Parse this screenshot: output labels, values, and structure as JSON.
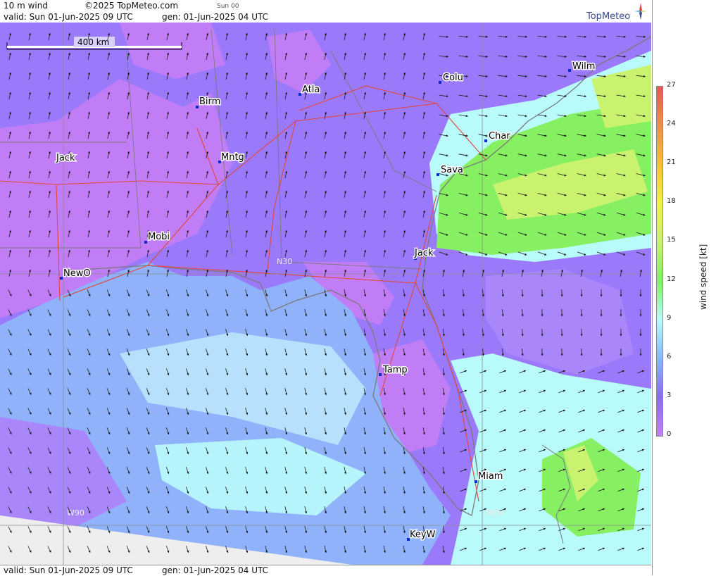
{
  "header": {
    "product": "10 m wind",
    "copyright": "©2025 TopMeteo.com",
    "step": "Sun 00",
    "valid": "valid:  Sun  01-Jun-2025  09 UTC",
    "generated": "gen: 01-Jun-2025 04 UTC",
    "logo_text": "TopMeteo"
  },
  "footer": {
    "valid": "valid:  Sun  01-Jun-2025  09 UTC",
    "generated": "gen: 01-Jun-2025 04 UTC"
  },
  "map": {
    "scale_bar_label": "400 km",
    "grid_labels": [
      "N30",
      "W90",
      "W80"
    ],
    "cities": [
      {
        "label": "Wilm"
      },
      {
        "label": "Colu"
      },
      {
        "label": "Atla"
      },
      {
        "label": "Birm"
      },
      {
        "label": "Char"
      },
      {
        "label": "Jack"
      },
      {
        "label": "Mntg"
      },
      {
        "label": "Sava"
      },
      {
        "label": "Mobi"
      },
      {
        "label": "Jack"
      },
      {
        "label": "NewO"
      },
      {
        "label": "Tamp"
      },
      {
        "label": "Miam"
      },
      {
        "label": "KeyW"
      }
    ]
  },
  "legend": {
    "title": "wind speed [kt]",
    "ticks": [
      "27",
      "24",
      "21",
      "18",
      "15",
      "12",
      "9",
      "6",
      "3",
      "0"
    ],
    "colors": [
      "#e8585a",
      "#ef8e47",
      "#f4c233",
      "#f2f242",
      "#c9f26e",
      "#86ef62",
      "#b9fbfb",
      "#87b8ff",
      "#8a6af2",
      "#c57ef8"
    ]
  }
}
